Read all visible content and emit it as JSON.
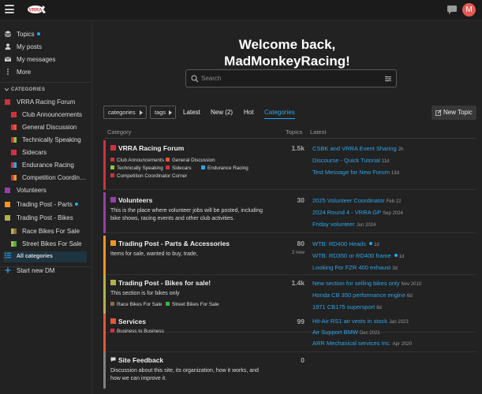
{
  "header": {
    "logo_text": "VRRA",
    "avatar_letter": "M",
    "avatar_color": "#e45a54",
    "chat_icon": "chat-bubble-icon",
    "menu_icon": "hamburger-icon"
  },
  "sidebar": {
    "nav": [
      {
        "label": "Topics",
        "icon": "layers-icon",
        "dot": true
      },
      {
        "label": "My posts",
        "icon": "user-icon"
      },
      {
        "label": "My messages",
        "icon": "envelope-icon"
      },
      {
        "label": "More",
        "icon": "more-vertical-icon"
      }
    ],
    "categories_heading": "CATEGORIES",
    "categories": [
      {
        "label": "VRRA Racing Forum",
        "color": "#d1313f"
      },
      {
        "label": "Club Announcements",
        "color": "#d1313f",
        "color2": "#d1313f"
      },
      {
        "label": "General Discussion",
        "color": "#d1313f",
        "color2": "#e45735"
      },
      {
        "label": "Technically Speaking",
        "color": "#d1313f",
        "color2": "#92c83e"
      },
      {
        "label": "Sidecars",
        "color": "#d1313f",
        "color2": "#d1313f"
      },
      {
        "label": "Endurance Racing",
        "color": "#d1313f",
        "color2": "#2ea5e8"
      },
      {
        "label": "Competition Coordinator",
        "color": "#d1313f",
        "color2": "#e8a02a"
      },
      {
        "label": "Volunteers",
        "color": "#9440a8"
      },
      {
        "label": "Trading Post - Parts",
        "color": "#f7941d",
        "dot": true
      },
      {
        "label": "Trading Post - Bikes",
        "color": "#b3b24a"
      },
      {
        "label": "Race Bikes For Sale",
        "color": "#b3b24a",
        "color2": "#8c6d46"
      },
      {
        "label": "Street Bikes For Sale",
        "color": "#b3b24a",
        "color2": "#3ab54a"
      }
    ],
    "all_categories": "All categories",
    "start_dm": "Start new DM"
  },
  "main": {
    "welcome_line1": "Welcome back,",
    "welcome_line2": "MadMonkeyRacing!",
    "search_placeholder": "Search",
    "filters": {
      "categories": "categories",
      "tags": "tags"
    },
    "tabs": [
      "Latest",
      "New (2)",
      "Hot",
      "Categories"
    ],
    "active_tab": "Categories",
    "new_topic": "New Topic",
    "columns": {
      "category": "Category",
      "topics": "Topics",
      "latest": "Latest"
    }
  },
  "categories": [
    {
      "name": "VRRA Racing Forum",
      "color": "#d1313f",
      "count": "1.5k",
      "subcategories": [
        {
          "name": "Club Announcements",
          "color": "#d1313f"
        },
        {
          "name": "General Discussion",
          "color": "#e45735"
        },
        {
          "name": "Technically Speaking",
          "color": "#92c83e"
        },
        {
          "name": "Sidecars",
          "color": "#d1313f"
        },
        {
          "name": "Endurance Racing",
          "color": "#2ea5e8"
        },
        {
          "name": "Competition Coordinator Corner",
          "color": "#d1313f"
        }
      ],
      "latest": [
        {
          "title": "CSBK and VRRA Event Sharing",
          "age": "2h"
        },
        {
          "title": "Discourse - Quick Tutorial",
          "age": "11d"
        },
        {
          "title": "Test Message for New Forum",
          "age": "13d"
        }
      ]
    },
    {
      "name": "Volunteers",
      "color": "#9440a8",
      "count": "30",
      "description": "This is the place where volunteer jobs will be posted, including bike shows, racing events and other club activities.",
      "latest": [
        {
          "title": "2025 Volunteer Coordinator",
          "age": "Feb 22"
        },
        {
          "title": "2024 Round 4 - VRRA GP",
          "age": "Sep 2024"
        },
        {
          "title": "Friday volunteer",
          "age": "Jun 2024"
        }
      ]
    },
    {
      "name": "Trading Post - Parts & Accessories",
      "color": "#f7941d",
      "count": "80",
      "new_count": "2 new",
      "description": "Items for sale, wanted to buy, trade,",
      "latest": [
        {
          "title": "WTB: RD400 Heads",
          "age": "1d",
          "unread": true
        },
        {
          "title": "WTB: RD350 or RD400 frame",
          "age": "1d",
          "unread": true
        },
        {
          "title": "Looking For FZR 400 exhaust",
          "age": "3d"
        }
      ]
    },
    {
      "name": "Trading Post - Bikes for sale!",
      "color": "#b3b24a",
      "count": "1.4k",
      "description": "This section is for bikes only",
      "subcategories": [
        {
          "name": "Race Bikes For Sale",
          "color": "#8c6d46"
        },
        {
          "name": "Street Bikes For Sale",
          "color": "#3ab54a"
        }
      ],
      "latest": [
        {
          "title": "New section for selling bikes only",
          "age": "Nov 2010"
        },
        {
          "title": "Honda CB 350 performance engine",
          "age": "6d"
        },
        {
          "title": "1971 CB175 supersport",
          "age": "8d"
        }
      ]
    },
    {
      "name": "Services",
      "color": "#e45735",
      "count": "99",
      "subcategories": [
        {
          "name": "Business to Business",
          "color": "#d1313f"
        }
      ],
      "latest": [
        {
          "title": "Hit-Air RS1 air vests in stock",
          "age": "Jan 2023"
        },
        {
          "title": "Air Support BMW",
          "age": "Dec 2021"
        },
        {
          "title": "ARR Mechanical services Inc.",
          "age": "Apr 2020"
        }
      ]
    },
    {
      "name": "Site Feedback",
      "color": "#808281",
      "count": "0",
      "icon": "speech-bubble-icon",
      "description": "Discussion about this site, its organization, how it works, and how we can improve it.",
      "latest": []
    }
  ]
}
